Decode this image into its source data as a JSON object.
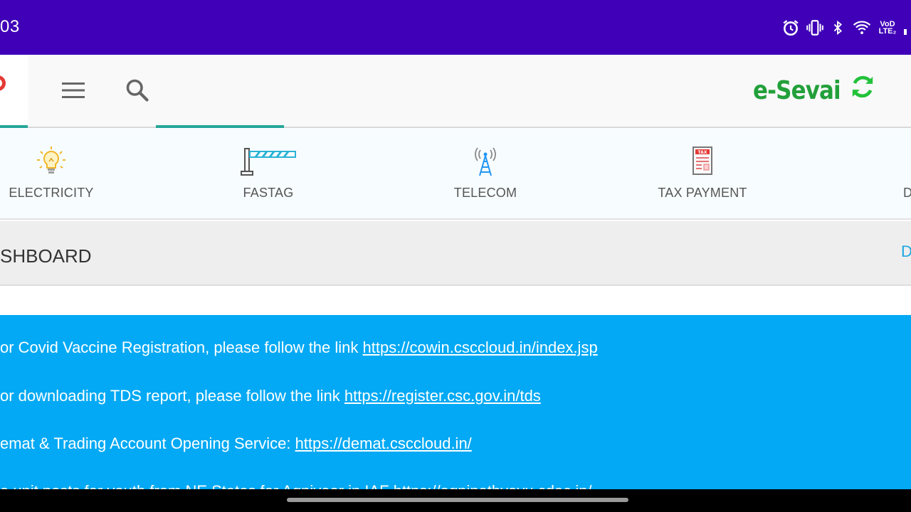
{
  "status_bar": {
    "time": "03",
    "volte_label_top": "VoD",
    "volte_label_bottom": "LTE₂"
  },
  "toolbar": {
    "brand_title": "e-Sevai",
    "colors": {
      "accent_teal": "#26a69a",
      "brand_green": "#22a03a"
    }
  },
  "services": [
    {
      "label": "ELECTRICITY",
      "icon": "light-bulb-icon"
    },
    {
      "label": "FASTAG",
      "icon": "toll-barrier-icon"
    },
    {
      "label": "TELECOM",
      "icon": "signal-tower-icon"
    },
    {
      "label": "TAX PAYMENT",
      "icon": "tax-document-icon"
    },
    {
      "label": "D",
      "icon": "device-icon"
    }
  ],
  "dashboard": {
    "title": "SHBOARD",
    "right_link": "D"
  },
  "notices": [
    {
      "text": "or Covid Vaccine Registration, please follow the link ",
      "link": "https://cowin.csccloud.in/index.jsp"
    },
    {
      "text": "or downloading TDS report, please follow the link ",
      "link": "https://register.csc.gov.in/tds"
    },
    {
      "text": "emat & Trading Account Opening Service: ",
      "link": "https://demat.csccloud.in/"
    },
    {
      "text": "e unit posts for youth from NE States for Agniveer in IAF ",
      "link": "https://agnipathvayu.cdac.in/"
    }
  ],
  "colors": {
    "status_bar": "#3f00b8",
    "notice_bg": "#03a9f4",
    "dashboard_link": "#1ea7e0"
  }
}
